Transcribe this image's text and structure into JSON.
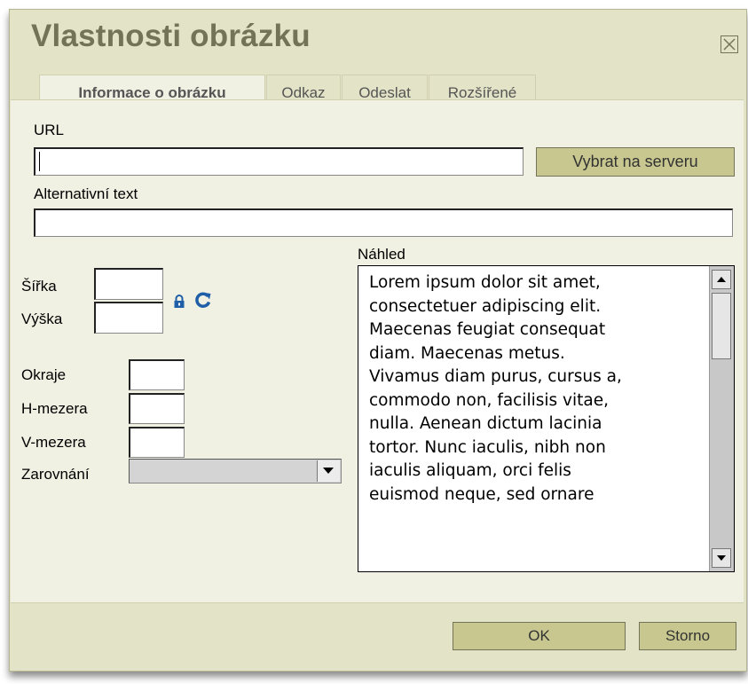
{
  "dialog": {
    "title": "Vlastnosti obrázku",
    "tabs": [
      {
        "label": "Informace o obrázku",
        "active": true
      },
      {
        "label": "Odkaz",
        "active": false
      },
      {
        "label": "Odeslat",
        "active": false
      },
      {
        "label": "Rozšířené",
        "active": false
      }
    ],
    "close_icon": "close-icon"
  },
  "form": {
    "url_label": "URL",
    "url_value": "",
    "browse_button": "Vybrat na serveru",
    "alt_label": "Alternativní text",
    "alt_value": "",
    "width_label": "Šířka",
    "height_label": "Výška",
    "width_value": "",
    "height_value": "",
    "lock_icon": "lock-icon",
    "reset_icon": "reset-size-icon",
    "border_label": "Okraje",
    "hspace_label": "H-mezera",
    "vspace_label": "V-mezera",
    "align_label": "Zarovnání",
    "border_value": "",
    "hspace_value": "",
    "vspace_value": "",
    "align_value": ""
  },
  "preview": {
    "label": "Náhled",
    "lines": [
      "Lorem ipsum dolor sit amet,",
      "consectetuer adipiscing elit.",
      "Maecenas feugiat consequat",
      "diam. Maecenas metus.",
      "Vivamus diam purus, cursus a,",
      "commodo non, facilisis vitae,",
      "nulla. Aenean dictum lacinia",
      "tortor. Nunc iaculis, nibh non",
      "iaculis aliquam, orci felis",
      "euismod neque, sed ornare"
    ]
  },
  "footer": {
    "ok": "OK",
    "cancel": "Storno"
  },
  "colors": {
    "dialog_bg": "#e3e3c7",
    "content_bg": "#f1f1e3",
    "title": "#737357",
    "button": "#c7c78f"
  }
}
